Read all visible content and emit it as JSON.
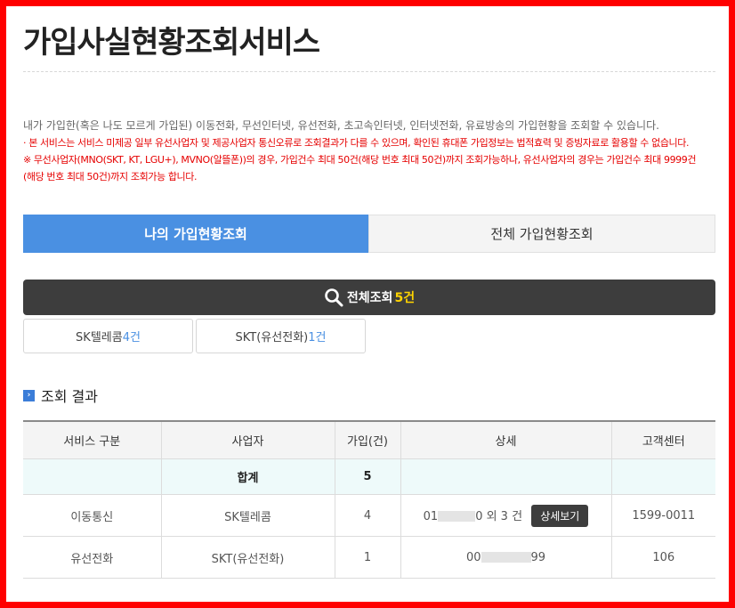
{
  "page": {
    "title": "가입사실현황조회서비스"
  },
  "notice": {
    "line1": "내가 가입한(혹은 나도 모르게 가입된) 이동전화, 무선인터넷, 유선전화, 초고속인터넷, 인터넷전화, 유료방송의 가입현황을 조회할 수 있습니다.",
    "line2": "· 본 서비스는 서비스 미제공 일부 유선사업자 및 제공사업자 통신오류로 조회결과가 다를 수 있으며, 확인된 휴대폰 가입정보는 법적효력 및 증빙자료로 활용할 수 없습니다.",
    "line3": "※ 무선사업자(MNO(SKT, KT, LGU+), MVNO(알뜰폰))의 경우, 가입건수 최대 50건(해당 번호 최대 50건)까지 조회가능하나, 유선사업자의 경우는 가입건수 최대 9999건",
    "line4": "(해당 번호 최대 50건)까지 조회가능 합니다."
  },
  "tabs": {
    "my": "나의 가입현황조회",
    "all": "전체 가입현황조회"
  },
  "search": {
    "label": "전체조회",
    "count": "5건"
  },
  "filters": [
    {
      "name": "SK텔레콤",
      "count": "4건"
    },
    {
      "name": "SKT(유선전화)",
      "count": "1건"
    }
  ],
  "results": {
    "title": "조회 결과",
    "headers": [
      "서비스 구분",
      "사업자",
      "가입(건)",
      "상세",
      "고객센터"
    ],
    "total_label": "합계",
    "total_value": "5",
    "rows": [
      {
        "service": "이동통신",
        "provider": "SK텔레콤",
        "count": "4",
        "detail_prefix": "01",
        "detail_suffix": "0 외 3 건",
        "button": "상세보기",
        "center": "1599-0011"
      },
      {
        "service": "유선전화",
        "provider": "SKT(유선전화)",
        "count": "1",
        "detail_prefix": "00",
        "detail_suffix": "99",
        "center": "106"
      }
    ]
  },
  "colors": {
    "frame": "#ff0000",
    "tab_active": "#4a90e2",
    "search_bar": "#3d3d3d",
    "notice_red": "#e60000",
    "count_highlight": "#ffd400"
  }
}
